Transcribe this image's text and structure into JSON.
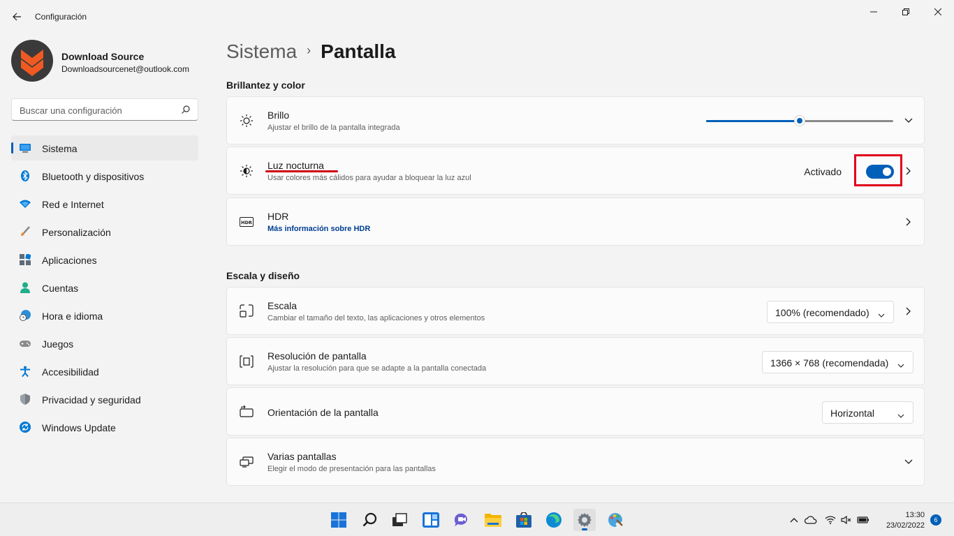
{
  "window": {
    "title": "Configuración",
    "accent": "#005fb8"
  },
  "profile": {
    "name": "Download Source",
    "email": "Downloadsourcenet@outlook.com"
  },
  "search": {
    "placeholder": "Buscar una configuración"
  },
  "sidebar": {
    "items": [
      {
        "label": "Sistema",
        "icon": "monitor-icon",
        "active": true
      },
      {
        "label": "Bluetooth y dispositivos",
        "icon": "bluetooth-icon"
      },
      {
        "label": "Red e Internet",
        "icon": "wifi-icon"
      },
      {
        "label": "Personalización",
        "icon": "brush-icon"
      },
      {
        "label": "Aplicaciones",
        "icon": "apps-icon"
      },
      {
        "label": "Cuentas",
        "icon": "person-icon"
      },
      {
        "label": "Hora e idioma",
        "icon": "globe-clock-icon"
      },
      {
        "label": "Juegos",
        "icon": "gamepad-icon"
      },
      {
        "label": "Accesibilidad",
        "icon": "accessibility-icon"
      },
      {
        "label": "Privacidad y seguridad",
        "icon": "shield-icon"
      },
      {
        "label": "Windows Update",
        "icon": "update-icon"
      }
    ]
  },
  "breadcrumb": {
    "parent": "Sistema",
    "separator": "›",
    "current": "Pantalla"
  },
  "sections": {
    "brightness_title": "Brillantez y color",
    "scale_title": "Escala y diseño"
  },
  "cards": {
    "brillo": {
      "title": "Brillo",
      "subtitle": "Ajustar el brillo de la pantalla integrada",
      "level": 0.5
    },
    "luz": {
      "title": "Luz nocturna",
      "subtitle": "Usar colores más cálidos para ayudar a bloquear la luz azul",
      "status": "Activado",
      "on": true
    },
    "hdr": {
      "title": "HDR",
      "link": "Más información sobre HDR"
    },
    "escala": {
      "title": "Escala",
      "subtitle": "Cambiar el tamaño del texto, las aplicaciones y otros elementos",
      "value": "100% (recomendado)"
    },
    "resolucion": {
      "title": "Resolución de pantalla",
      "subtitle": "Ajustar la resolución para que se adapte a la pantalla conectada",
      "value": "1366 × 768 (recomendada)"
    },
    "orientacion": {
      "title": "Orientación de la pantalla",
      "value": "Horizontal"
    },
    "varias": {
      "title": "Varias pantallas",
      "subtitle": "Elegir el modo de presentación para las pantallas"
    }
  },
  "taskbar": {
    "time": "13:30",
    "date": "23/02/2022",
    "notifications": "6"
  }
}
